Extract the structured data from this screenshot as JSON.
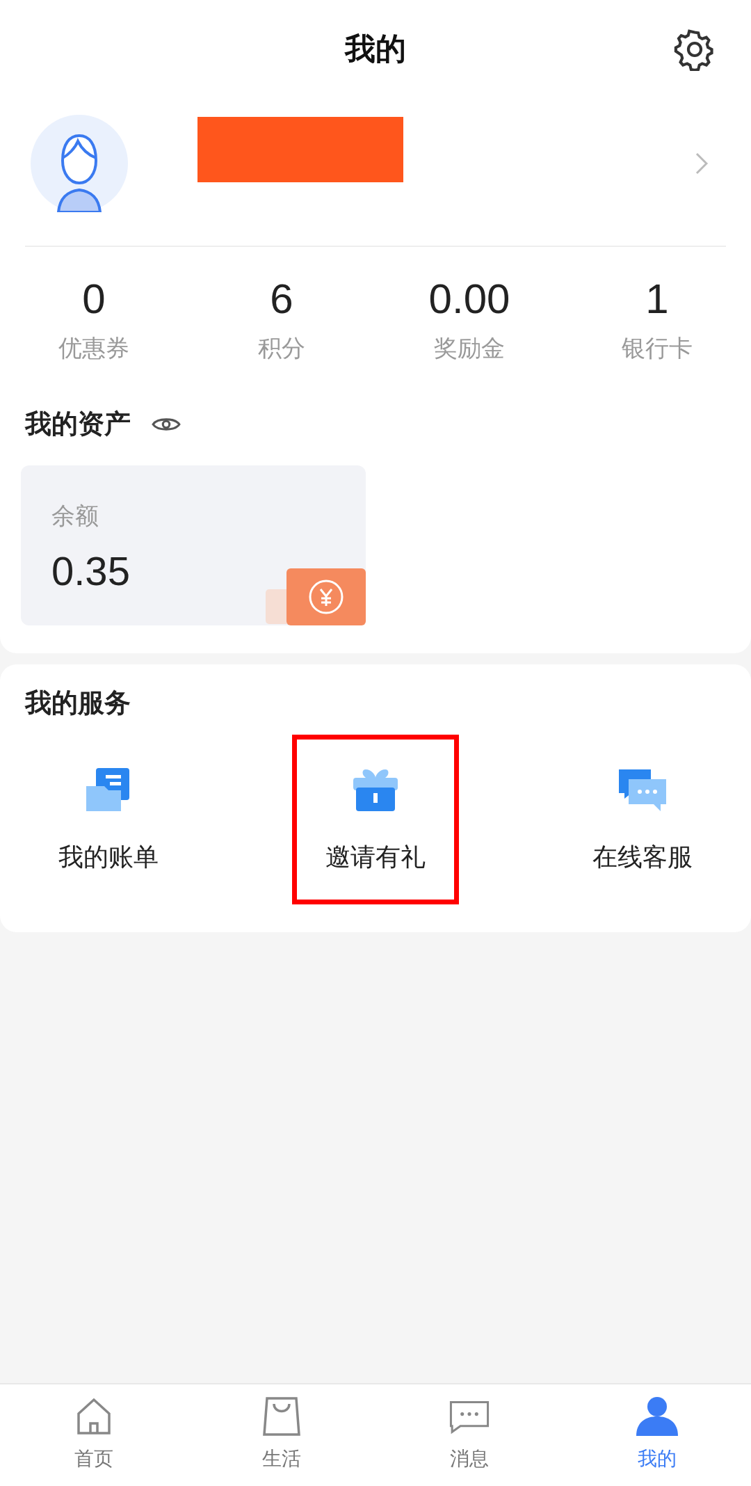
{
  "header": {
    "title": "我的"
  },
  "profile": {
    "redacted": true
  },
  "stats": [
    {
      "value": "0",
      "label": "优惠券"
    },
    {
      "value": "6",
      "label": "积分"
    },
    {
      "value": "0.00",
      "label": "奖励金"
    },
    {
      "value": "1",
      "label": "银行卡"
    }
  ],
  "assets": {
    "title": "我的资产",
    "balance_label": "余额",
    "balance": "0.35"
  },
  "services": {
    "title": "我的服务",
    "items": [
      {
        "kind": "bill",
        "label": "我的账单",
        "highlighted": false
      },
      {
        "kind": "gift",
        "label": "邀请有礼",
        "highlighted": true
      },
      {
        "kind": "chat",
        "label": "在线客服",
        "highlighted": false
      }
    ]
  },
  "tab_bar": [
    {
      "kind": "home",
      "label": "首页",
      "selected": false
    },
    {
      "kind": "bag",
      "label": "生活",
      "selected": false
    },
    {
      "kind": "message",
      "label": "消息",
      "selected": false
    },
    {
      "kind": "user",
      "label": "我的",
      "selected": true
    }
  ]
}
